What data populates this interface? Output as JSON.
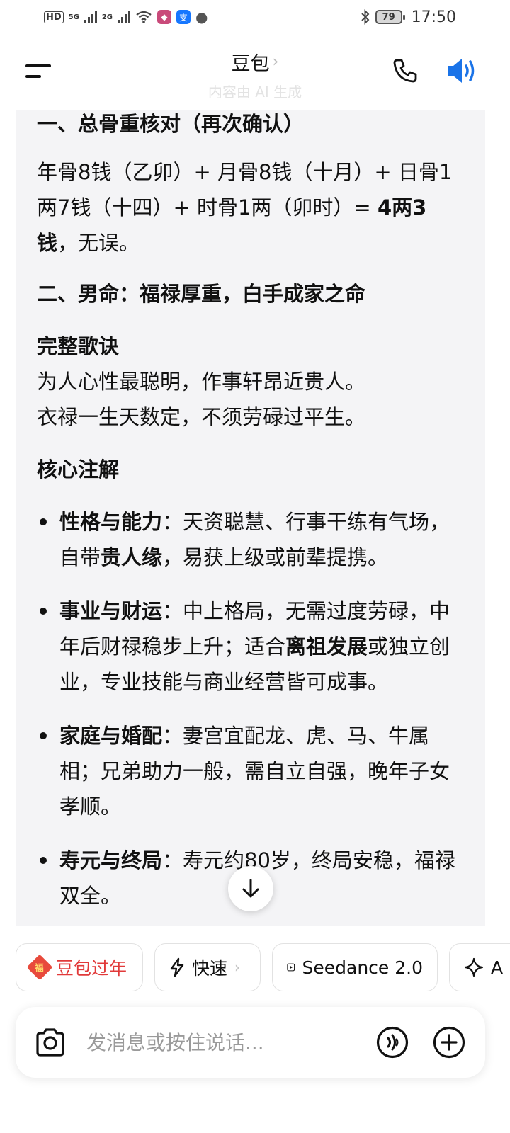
{
  "status_bar": {
    "network_hd": "HD",
    "net1": "5G",
    "net2": "2G",
    "battery": "79",
    "time": "17:50"
  },
  "header": {
    "title": "豆包",
    "subtitle_ghost": "内容由 AI 生成"
  },
  "message": {
    "section1_title": "一、总骨重核对（再次确认）",
    "section1_text_prefix": "年骨8钱（乙卯）+ 月骨8钱（十月）+ 日骨1两7钱（十四）+ 时骨1两（卯时）= ",
    "section1_text_bold": "4两3钱",
    "section1_text_suffix": "，无误。",
    "section2_title": "二、男命：福禄厚重，白手成家之命",
    "verse_title": "完整歌诀",
    "verse_line1": "为人心性最聪明，作事轩昂近贵人。",
    "verse_line2": "衣禄一生天数定，不须劳碌过平生。",
    "notes_title": "核心注解",
    "bullets": [
      {
        "title": "性格与能力",
        "text1": "：天资聪慧、行事干练有气场，自带",
        "bold": "贵人缘",
        "text2": "，易获上级或前辈提携。"
      },
      {
        "title": "事业与财运",
        "text1": "：中上格局，无需过度劳碌，中年后财禄稳步上升；适合",
        "bold": "离祖发展",
        "text2": "或独立创业，专业技能与商业经营皆可成事。"
      },
      {
        "title": "家庭与婚配",
        "text1": "：妻宫宜配龙、虎、马、牛属相；兄弟助力一般，需自立自强，晚年子女孝顺。",
        "bold": "",
        "text2": ""
      },
      {
        "title": "寿元与终局",
        "text1": "：寿元约80岁，终局安稳，福禄双全。",
        "bold": "",
        "text2": ""
      }
    ]
  },
  "chips": {
    "festival": "豆包过年",
    "fast": "快速",
    "seedance": "Seedance 2.0",
    "more": "A"
  },
  "input": {
    "placeholder": "发消息或按住说话..."
  },
  "colors": {
    "accent_blue": "#1a73e8",
    "festival_red": "#e13a3a",
    "card_bg": "#f4f4f6"
  }
}
